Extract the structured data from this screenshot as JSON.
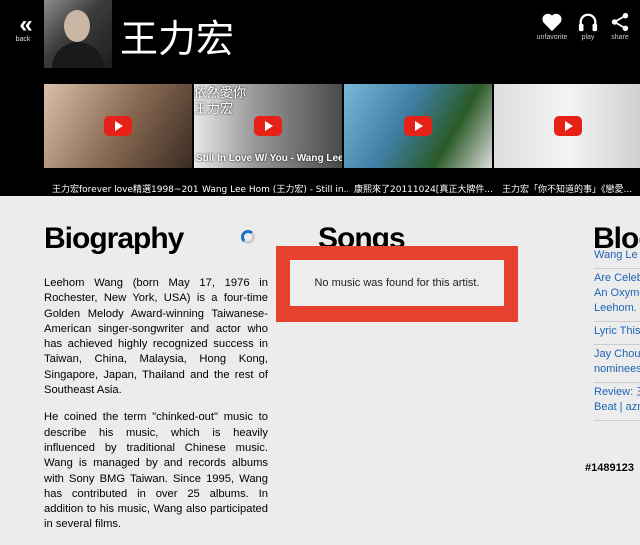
{
  "header": {
    "back_label": "back",
    "artist_name": "王力宏",
    "actions": [
      {
        "icon": "heart-icon",
        "label": "unfavorite"
      },
      {
        "icon": "headphones-icon",
        "label": "play"
      },
      {
        "icon": "share-icon",
        "label": "share"
      }
    ]
  },
  "videos": [
    {
      "caption": "王力宏forever love精選1998~2011",
      "overlay": ""
    },
    {
      "caption": "Wang Lee Hom (王力宏) - Still in...",
      "overlay": "依然愛你\n王力宏",
      "overlay2": "Still In Love W/ You - Wang Lee Hom"
    },
    {
      "caption": "康熙來了20111024[真正大牌件...",
      "overlay": "",
      "overlay2": ""
    },
    {
      "caption": "王力宏「你不知道的事」《戀愛...",
      "overlay": "",
      "overlay2": ""
    }
  ],
  "biography": {
    "heading": "Biography",
    "paragraphs": [
      "Leehom Wang (born May 17, 1976 in Rochester, New York, USA) is a four-time Golden Melody Award-winning Taiwanese-American singer-songwriter and actor who has achieved highly recognized success in Taiwan, China, Malaysia, Hong Kong, Singapore, Japan, Thailand and the rest of Southeast Asia.",
      "He coined the term \"chinked-out\" music to describe his music, which is heavily influenced by traditional Chinese music. Wang is managed by and records albums with Sony BMG Taiwan. Since 1995, Wang has contributed in over 25 albums. In addition to his music, Wang also participated in several films."
    ]
  },
  "songs": {
    "heading": "Songs",
    "empty_message": "No music was found for this artist."
  },
  "blogs": {
    "heading": "Blog",
    "items": [
      "Wang Le",
      "Are Celeb\nAn Oxymo\nLeehom.",
      "Lyric This",
      "Jay Chou\nnominees",
      "Review: 三\nBeat | azn"
    ]
  },
  "watermark": "#1489123"
}
